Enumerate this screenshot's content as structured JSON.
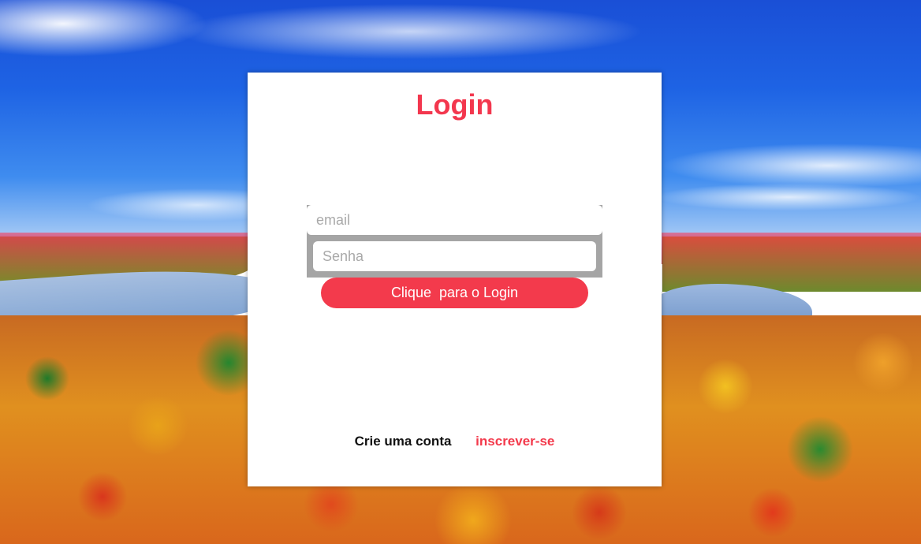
{
  "login": {
    "title": "Login",
    "email_placeholder": "email",
    "password_placeholder": "Senha",
    "submit_label": "Clique  para o Login",
    "create_account_label": "Crie uma conta",
    "signup_link": "inscrever-se"
  },
  "colors": {
    "accent": "#f33a4c",
    "card": "#ffffff",
    "form_box": "#a5a5a5"
  }
}
